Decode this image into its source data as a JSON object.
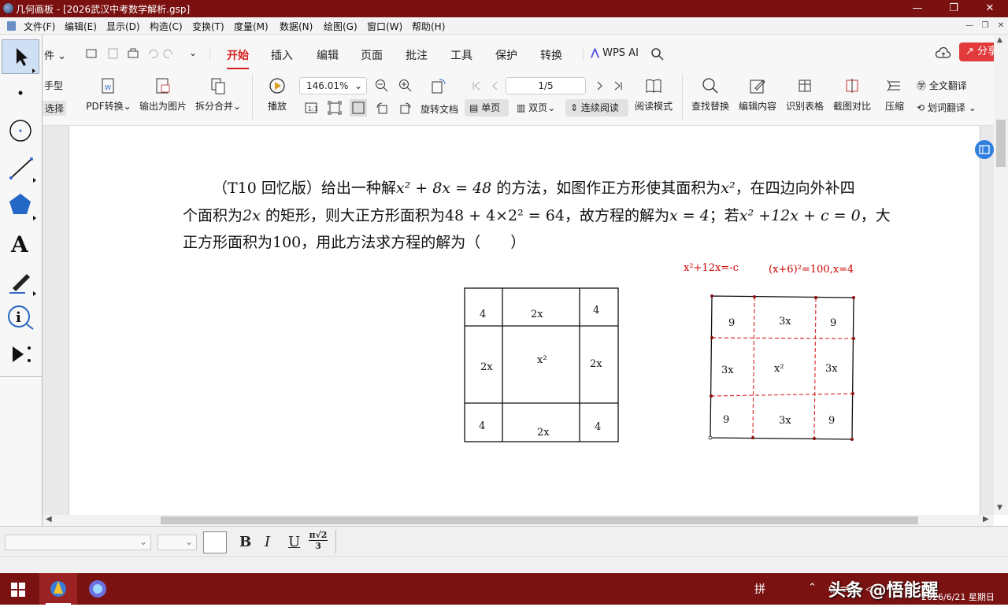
{
  "window": {
    "title": "几何画板 - [2026武汉中考数学解析.gsp]",
    "controls": {
      "minimize": "—",
      "maximize": "❐",
      "close": "✕"
    }
  },
  "menu": {
    "items": [
      "文件(F)",
      "编辑(E)",
      "显示(D)",
      "构造(C)",
      "变换(T)",
      "度量(M)",
      "数据(N)",
      "绘图(G)",
      "窗口(W)",
      "帮助(H)"
    ]
  },
  "ribbon": {
    "file_label": "件",
    "tabs": [
      "开始",
      "插入",
      "编辑",
      "页面",
      "批注",
      "工具",
      "保护",
      "转换"
    ],
    "active_tab": "开始",
    "wps_ai": "WPS AI",
    "share": "分享",
    "hand_label": "手型",
    "select_label": "选择",
    "pdf_convert": "PDF转换",
    "export_image": "输出为图片",
    "split_merge": "拆分合并",
    "play": "播放",
    "zoom_value": "146.01%",
    "page_value": "1/5",
    "rotate_doc": "旋转文档",
    "single_page": "单页",
    "double_page": "双页",
    "continuous": "连续阅读",
    "reading_mode": "阅读模式",
    "find_replace": "查找替换",
    "edit_content": "编辑内容",
    "recognize_table": "识别表格",
    "screenshot_compare": "截图对比",
    "compress": "压缩",
    "full_translate": "全文翻译",
    "word_translate": "划词翻译"
  },
  "problem": {
    "line1_a": "（T10 回忆版）给出一种解",
    "line1_b": "的方法，如图作正方形使其面积为",
    "line1_c": "，在四边向外补四",
    "line2_a": "个面积为",
    "line2_b": "的矩形，则大正方形面积为",
    "line2_c": "，故方程的解为",
    "line2_d": "；若",
    "line2_e": "，大",
    "line3": "正方形面积为100，用此方法求方程的解为（　　）",
    "eq1": "x² + 8x = 48",
    "area_small": "x²",
    "rect_area": "2x",
    "big_area": "48 + 4×2² = 64",
    "solution": "x = 4",
    "eq2": "x² +12x + c = 0"
  },
  "annotations": {
    "note1": "x²+12x=-c",
    "note2": "(x+6)²=100,x=4"
  },
  "figure1": {
    "cells": [
      "4",
      "2x",
      "4",
      "2x",
      "x²",
      "2x",
      "4",
      "2x",
      "4"
    ]
  },
  "figure2": {
    "cells": [
      "9",
      "3x",
      "9",
      "3x",
      "x²",
      "3x",
      "9",
      "3x",
      "9"
    ]
  },
  "formatbar": {
    "bold": "B",
    "italic": "I",
    "underline": "U",
    "math_top": "π√2",
    "math_bottom": "3"
  },
  "taskbar": {
    "datetime": "2026/6/21 星期日",
    "watermark": "头条 @悟能醒",
    "ime": "拼"
  },
  "colors": {
    "titlebar": "#7a1010",
    "accent_red": "#d61f1f",
    "annotation_red": "#cc0000"
  }
}
